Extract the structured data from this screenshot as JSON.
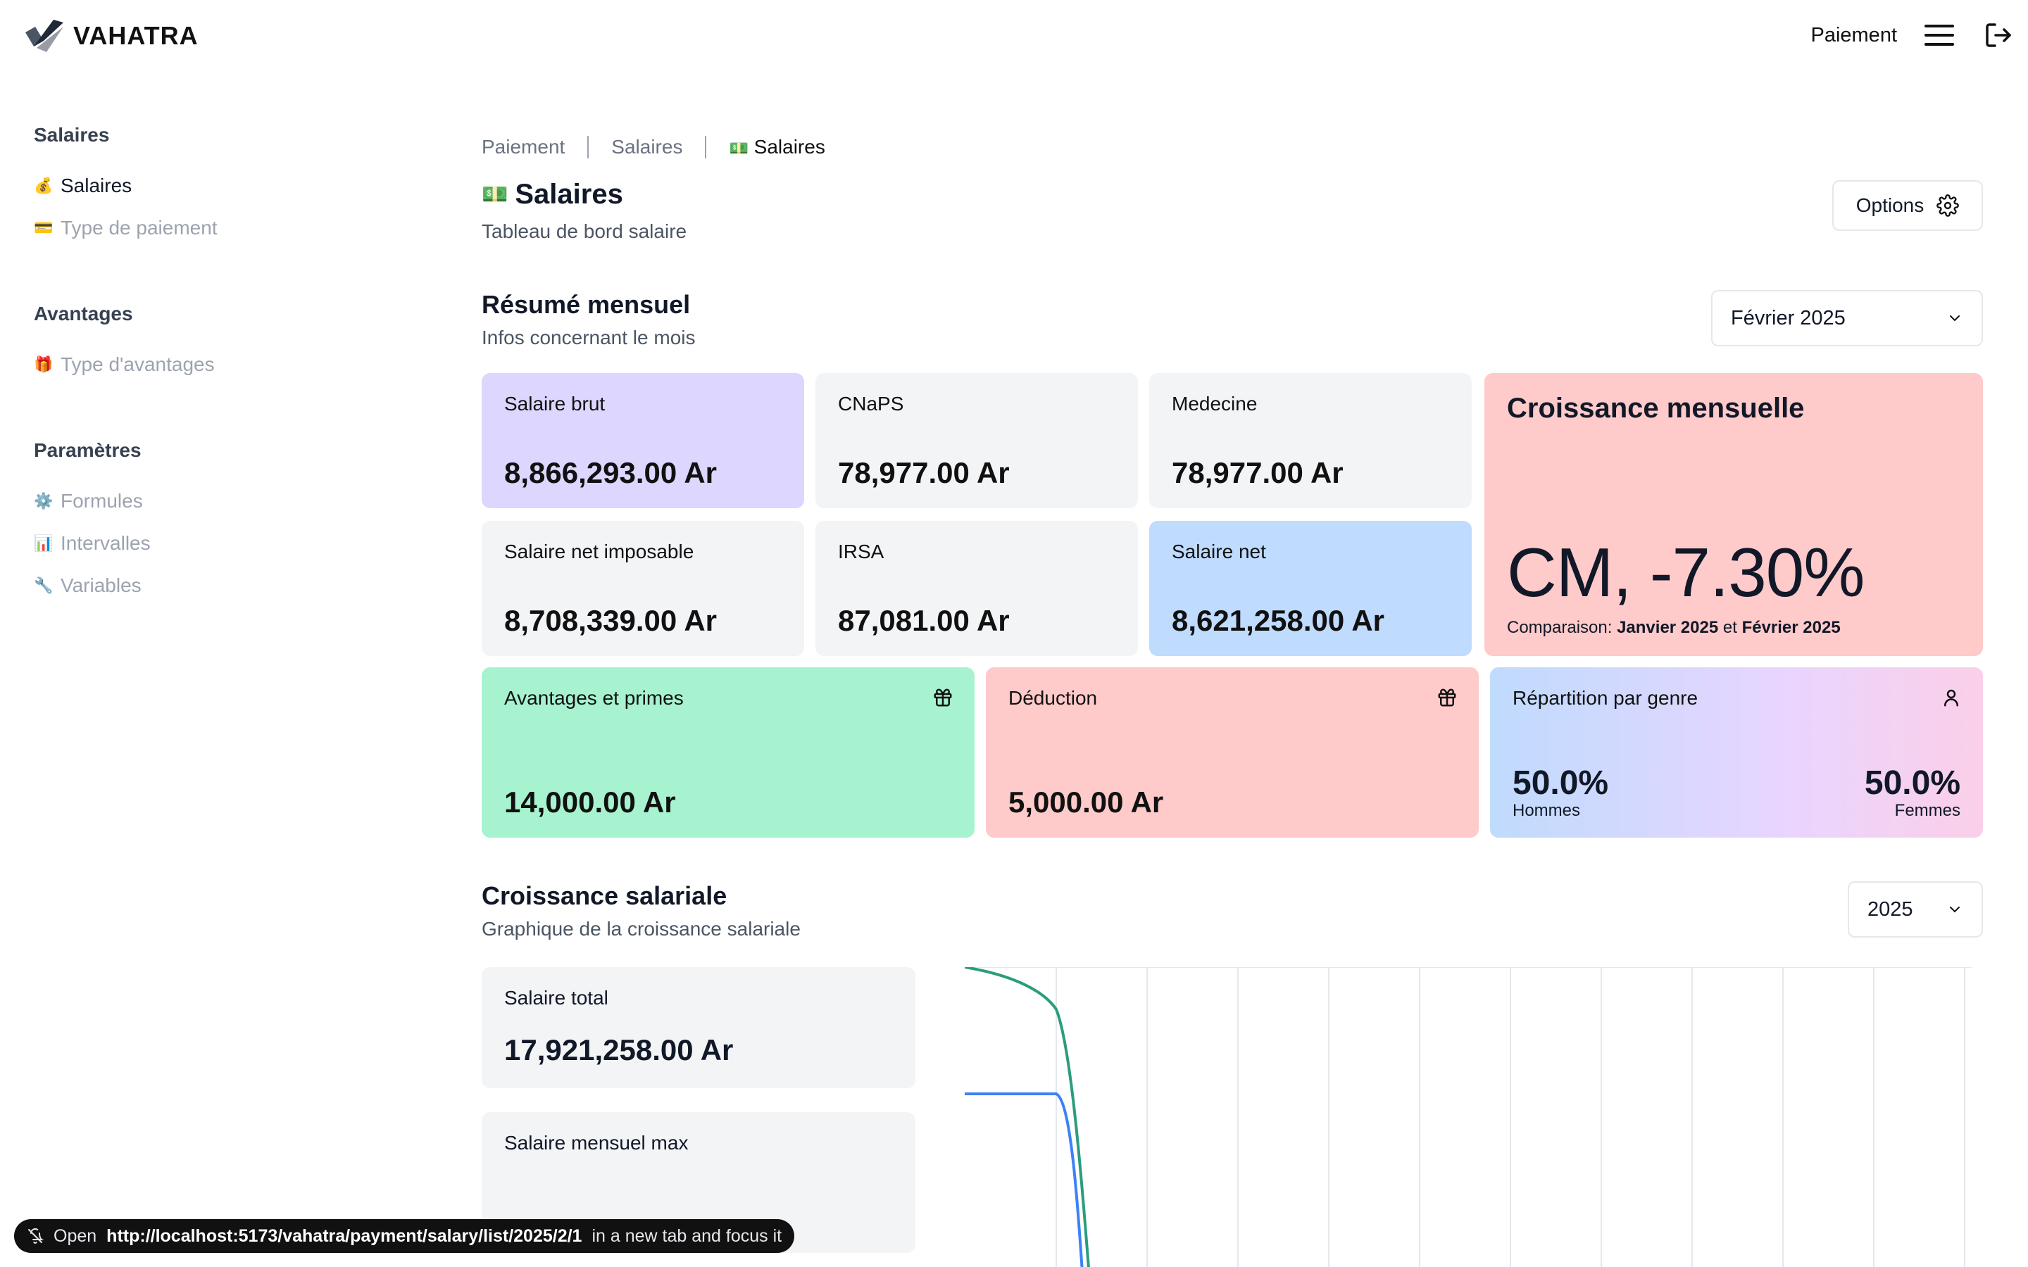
{
  "app": {
    "brand": "VAHATRA",
    "top_nav_label": "Paiement"
  },
  "sidebar": {
    "sections": [
      {
        "title": "Salaires",
        "items": [
          {
            "emoji": "💰",
            "label": "Salaires",
            "active": true
          },
          {
            "emoji": "💳",
            "label": "Type de paiement"
          }
        ]
      },
      {
        "title": "Avantages",
        "items": [
          {
            "emoji": "🎁",
            "label": "Type d'avantages"
          }
        ]
      },
      {
        "title": "Paramètres",
        "items": [
          {
            "emoji": "⚙️",
            "label": "Formules"
          },
          {
            "emoji": "📊",
            "label": "Intervalles"
          },
          {
            "emoji": "🔧",
            "label": "Variables"
          }
        ]
      }
    ]
  },
  "breadcrumb": {
    "items": [
      "Paiement",
      "Salaires"
    ],
    "current_emoji": "💵",
    "current": "Salaires"
  },
  "page": {
    "title_emoji": "💵",
    "title": "Salaires",
    "subtitle": "Tableau de bord salaire",
    "options_label": "Options"
  },
  "summary": {
    "title": "Résumé mensuel",
    "subtitle": "Infos concernant le mois",
    "month_select": "Février 2025",
    "cards": {
      "salaire_brut": {
        "label": "Salaire brut",
        "value": "8,866,293.00 Ar"
      },
      "cnaps": {
        "label": "CNaPS",
        "value": "78,977.00 Ar"
      },
      "medecine": {
        "label": "Medecine",
        "value": "78,977.00 Ar"
      },
      "net_imposable": {
        "label": "Salaire net imposable",
        "value": "8,708,339.00 Ar"
      },
      "irsa": {
        "label": "IRSA",
        "value": "87,081.00 Ar"
      },
      "salaire_net": {
        "label": "Salaire net",
        "value": "8,621,258.00 Ar"
      },
      "avantages": {
        "label": "Avantages et primes",
        "value": "14,000.00 Ar"
      },
      "deduction": {
        "label": "Déduction",
        "value": "5,000.00 Ar"
      }
    },
    "growth": {
      "title": "Croissance mensuelle",
      "value": "CM, -7.30%",
      "cmp_prefix": "Comparaison:",
      "cmp_from": "Janvier 2025",
      "cmp_and": "et",
      "cmp_to": "Février 2025"
    },
    "gender": {
      "title": "Répartition par genre",
      "men_value": "50.0%",
      "men_label": "Hommes",
      "women_value": "50.0%",
      "women_label": "Femmes"
    }
  },
  "growth_section": {
    "title": "Croissance salariale",
    "subtitle": "Graphique de la croissance salariale",
    "year_select": "2025",
    "total": {
      "label": "Salaire total",
      "value": "17,921,258.00 Ar"
    },
    "max": {
      "label": "Salaire mensuel max"
    },
    "colors": {
      "green_series": "#2a9d7c",
      "blue_series": "#3b82f6"
    }
  },
  "status_bar": {
    "prefix": "Open",
    "url": "http://localhost:5173/vahatra/payment/salary/list/2025/2/1",
    "suffix": "in a new tab and focus it"
  }
}
